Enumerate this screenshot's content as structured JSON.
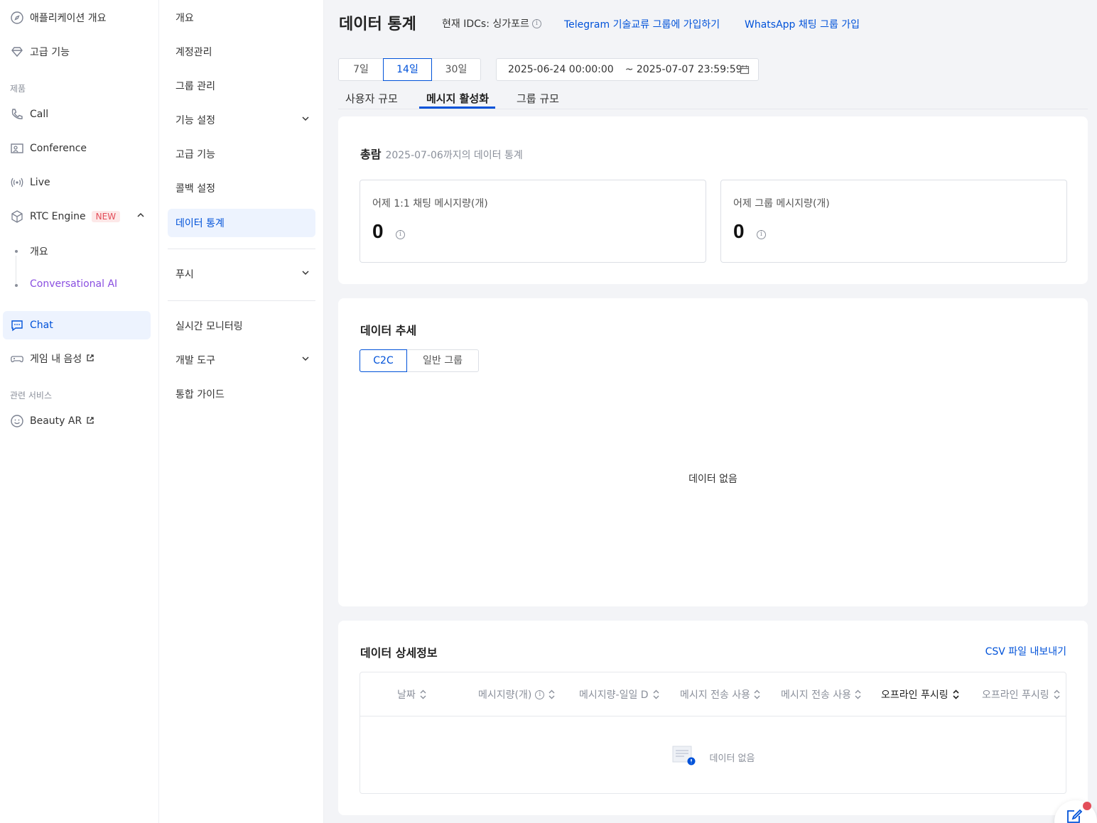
{
  "sidebar": {
    "items": [
      {
        "label": "애플리케이션 개요",
        "icon": "compass-icon"
      },
      {
        "label": "고급 기능",
        "icon": "diamond-icon"
      },
      {
        "label": "Call",
        "icon": "phone-icon"
      },
      {
        "label": "Conference",
        "icon": "conference-icon"
      },
      {
        "label": "Live",
        "icon": "broadcast-icon"
      },
      {
        "label": "RTC Engine",
        "icon": "cube-icon",
        "badge": "NEW"
      },
      {
        "label": "Chat",
        "icon": "chat-icon"
      },
      {
        "label": "게임 내 음성",
        "icon": "gamepad-icon"
      },
      {
        "label": "Beauty AR",
        "icon": "smile-icon"
      }
    ],
    "section_products": "제품",
    "section_related": "관련 서비스",
    "rtc_sub": [
      "개요",
      "Conversational AI"
    ]
  },
  "subnav": {
    "items": [
      "개요",
      "계정관리",
      "그룹 관리",
      "기능 설정",
      "고급 기능",
      "콜백 설정",
      "데이터 통계",
      "푸시",
      "실시간 모니터링",
      "개발 도구",
      "통합 가이드"
    ]
  },
  "header": {
    "title": "데이터 통계",
    "idc": "현재 IDCs: 싱가포르",
    "link_telegram": "Telegram 기술교류 그룹에 가입하기",
    "link_whatsapp": "WhatsApp 채팅 그룹 가입"
  },
  "range": {
    "options": [
      "7일",
      "14일",
      "30일"
    ],
    "start": "2025-06-24 00:00:00",
    "end": "~ 2025-07-07 23:59:59"
  },
  "tabs": [
    "사용자 규모",
    "메시지 활성화",
    "그룹 규모"
  ],
  "overview": {
    "title": "총람",
    "subtitle": "2025-07-06까지의 데이터 통계",
    "stats": [
      {
        "label": "어제 1:1 채팅 메시지량(개)",
        "value": "0"
      },
      {
        "label": "어제 그룹 메시지량(개)",
        "value": "0"
      }
    ]
  },
  "trend": {
    "title": "데이터 추세",
    "toggle": [
      "C2C",
      "일반 그룹"
    ],
    "no_data": "데이터 없음"
  },
  "detail": {
    "title": "데이터 상세정보",
    "export": "CSV 파일 내보내기",
    "columns": [
      "날짜",
      "메시지량(개)",
      "메시지량-일일 D",
      "메시지 전송 사용",
      "메시지 전송 사용",
      "오프라인 푸시링",
      "오프라인 푸시링"
    ],
    "empty": "데이터 없음"
  },
  "colors": {
    "accent": "#0052d9",
    "badge": "#e34d59",
    "ai": "#8a4fe0"
  }
}
